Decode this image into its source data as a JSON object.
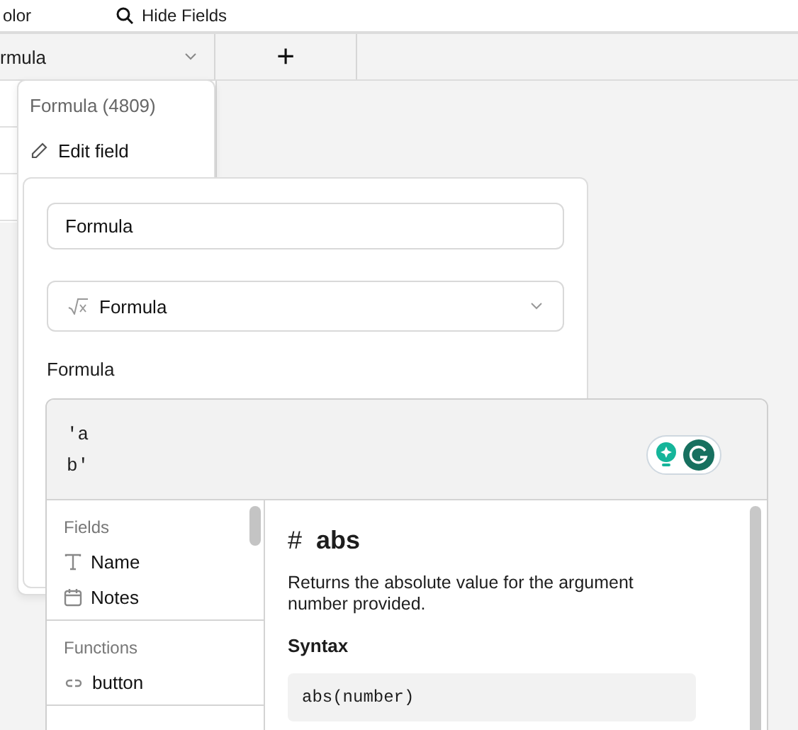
{
  "toolbar": {
    "color_label": "olor",
    "hide_fields_label": "Hide Fields"
  },
  "header": {
    "column_label": "rmula",
    "add_button": "+"
  },
  "field_menu": {
    "title": "Formula (4809)",
    "items": [
      {
        "label": "Edit field"
      }
    ]
  },
  "field_editor": {
    "name_value": "Formula",
    "type_label": "Formula",
    "formula_label": "Formula",
    "formula_lines": [
      "'a",
      "b'"
    ]
  },
  "reference": {
    "sections": [
      {
        "title": "Fields",
        "items": [
          {
            "label": "Name",
            "kind": "text"
          },
          {
            "label": "Notes",
            "kind": "date"
          }
        ]
      },
      {
        "title": "Functions",
        "items": [
          {
            "label": "button",
            "kind": "link"
          }
        ]
      }
    ],
    "doc": {
      "symbol": "#",
      "name": "abs",
      "description": "Returns the absolute value for the argument number provided.",
      "syntax_label": "Syntax",
      "syntax": "abs(number)"
    }
  }
}
